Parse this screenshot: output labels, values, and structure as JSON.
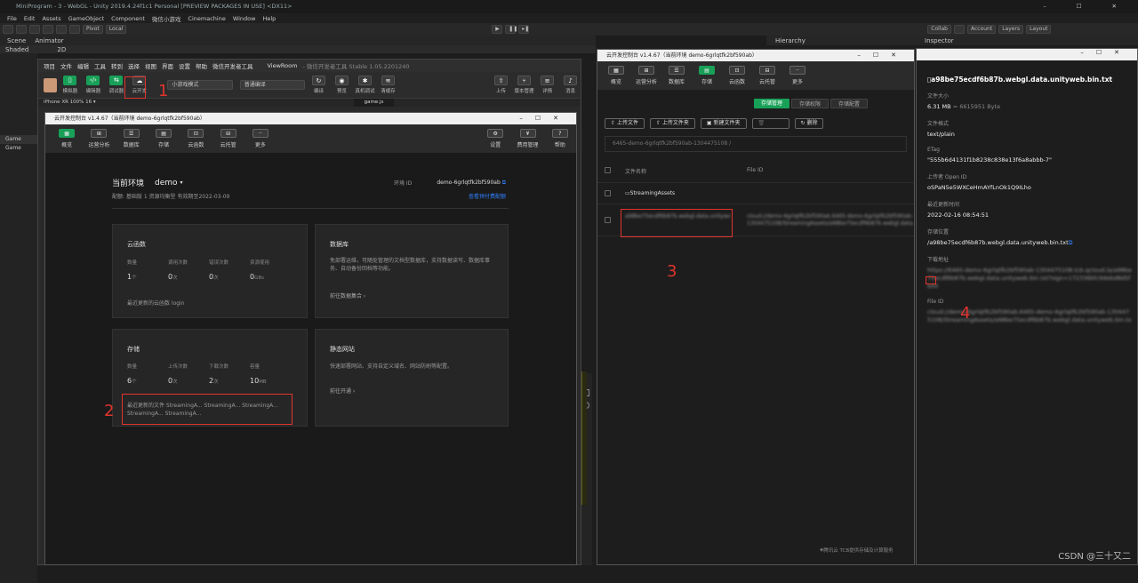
{
  "unity": {
    "title": "MiniProgram - 3 - WebGL - Unity 2019.4.24f1c1 Personal [PREVIEW PACKAGES IN USE] <DX11>",
    "menu": [
      "File",
      "Edit",
      "Assets",
      "GameObject",
      "Component",
      "微信小游戏",
      "Cinemachine",
      "Window",
      "Help"
    ],
    "toolbar": {
      "pivot": "Pivot",
      "local": "Local",
      "collab": "Collab",
      "account": "Account",
      "layers": "Layers",
      "layout": "Layout"
    },
    "tabs": {
      "scene": "Scene",
      "animator": "Animator",
      "shaded": "Shaded",
      "twod": "2D",
      "game": "Game",
      "hierarchy": "Hierarchy",
      "inspector": "Inspector"
    }
  },
  "devtool": {
    "menu": [
      "项目",
      "文件",
      "编辑",
      "工具",
      "转到",
      "选择",
      "视图",
      "界面",
      "设置",
      "帮助",
      "微信开发者工具"
    ],
    "project": "ViewRoom",
    "version": "- 微信开发者工具 Stable 1.05.2201240",
    "toolbar_buttons": [
      "模拟器",
      "编辑器",
      "调试器",
      "云开发"
    ],
    "mode_select": "小游戏模式",
    "compile_select": "普通编译",
    "right_buttons": [
      "编译",
      "预览",
      "真机调试",
      "清缓存",
      "上传",
      "版本管理",
      "详情",
      "消息"
    ],
    "sim_label": "iPhone XR 100% 16 ▾",
    "file_tab": "game.js"
  },
  "console1": {
    "title": "云开发控制台 v1.4.67（当前环境 demo-6grlqtfk2bf590ab）",
    "nav": [
      "概览",
      "运营分析",
      "数据库",
      "存储",
      "云函数",
      "云托管",
      "更多"
    ],
    "nav_right": [
      "设置",
      "费用管理",
      "帮助"
    ],
    "env_label": "当前环境",
    "env_name": "demo",
    "env_id_label": "环境 ID",
    "env_id": "demo-6grlqtfk2bf590ab",
    "quota": "配额: 基础版 1 资源均衡型 有效期至2022-03-09",
    "quota_link": "查看预付费配额",
    "functions": {
      "title": "云函数",
      "stats": [
        {
          "label": "数量",
          "value": "1",
          "unit": "个"
        },
        {
          "label": "调用次数",
          "value": "0",
          "unit": "次"
        },
        {
          "label": "错误次数",
          "value": "0",
          "unit": "次"
        },
        {
          "label": "资源使用",
          "value": "0",
          "unit": "GBs"
        }
      ],
      "recent": "最近更新的云函数  login"
    },
    "database": {
      "title": "数据库",
      "desc": "免部署运维，可随处管理的文档型数据库，支持数据读写、数据库事务、自动备份回档等功能。",
      "link": "前往数据集合 ›"
    },
    "storage": {
      "title": "存储",
      "stats": [
        {
          "label": "数量",
          "value": "6",
          "unit": "个"
        },
        {
          "label": "上传次数",
          "value": "0",
          "unit": "次"
        },
        {
          "label": "下载次数",
          "value": "2",
          "unit": "次"
        },
        {
          "label": "容量",
          "value": "10",
          "unit": "MB"
        }
      ],
      "recent": "最近更新的文件  StreamingA...  StreamingA...  StreamingA...  StreamingA...  StreamingA..."
    },
    "hosting": {
      "title": "静态网站",
      "desc": "快速部署网站、支持自定义域名、网站防刷等配置。",
      "link": "前往开通 ›"
    }
  },
  "console2": {
    "title": "云开发控制台 v1.4.67（当前环境 demo-6grlqtfk2bf590ab）",
    "nav": [
      "概览",
      "运营分析",
      "数据库",
      "存储",
      "云函数",
      "云托管",
      "更多"
    ],
    "tabs": [
      "存储管理",
      "存储权限",
      "存储配置"
    ],
    "buttons": [
      "上传文件",
      "上传文件夹",
      "新建文件夹",
      "删除",
      "删除"
    ],
    "path": "6465-demo-6grlqtfk2bf590ab-1304475108 /",
    "col_name": "文件名称",
    "col_id": "File ID",
    "folder": "StreamingAssets",
    "file_name": "a98be75ecdf6b87b.webgl.data.unityweb.bin.txt",
    "file_id": "cloud://demo-6grlqtfk2bf590ab.6465-demo-6grlqtfk2bf590ab-1304475108/StreamingAssets/a98be75ecdf6b87b.webgl.data.unityweb.bin.txt",
    "footer": "腾讯云 TCB提供存储及计算服务"
  },
  "inspector": {
    "file_title": "a98be75ecdf6b87b.webgl.data.unityweb.bin.txt",
    "fields": [
      {
        "label": "文件大小",
        "value": "6.31 MB",
        "sub": "= 6615951 Byte"
      },
      {
        "label": "文件格式",
        "value": "text/plain"
      },
      {
        "label": "ETag",
        "value": "\"555b6d4131f1b8238c838e13f6a8abbb-7\""
      },
      {
        "label": "上传者 Open ID",
        "value": "oSPaN5e5WXCeHmAYfLnOk1Q9ILho"
      },
      {
        "label": "最近更新时间",
        "value": "2022-02-16 08:54:51"
      },
      {
        "label": "存储位置",
        "value": "/a98be75ecdf6b87b.webgl.data.unityweb.bin.txt"
      },
      {
        "label": "下载地址",
        "value": "https://6465-demo-6grlqtfk2bf590ab-1304475108.tcb.qcloud.la/a98be75ecdf6b87b.webgl.data.unityweb.bin.txt?sign=172336bfc9debd8d5fb00"
      },
      {
        "label": "File ID",
        "value": "cloud://demo-6grlqtfk2bf590ab.6465-demo-6grlqtfk2bf590ab-1304475108/StreamingAssets/a98be75ecdf6b87b.webgl.data.unityweb.bin.txt"
      }
    ]
  },
  "annotations": [
    "1",
    "2",
    "3",
    "4"
  ],
  "watermark": "CSDN @三十又二",
  "colors": {
    "accent": "#18a058",
    "annotation": "#e0342e",
    "link": "#2f7fff"
  }
}
